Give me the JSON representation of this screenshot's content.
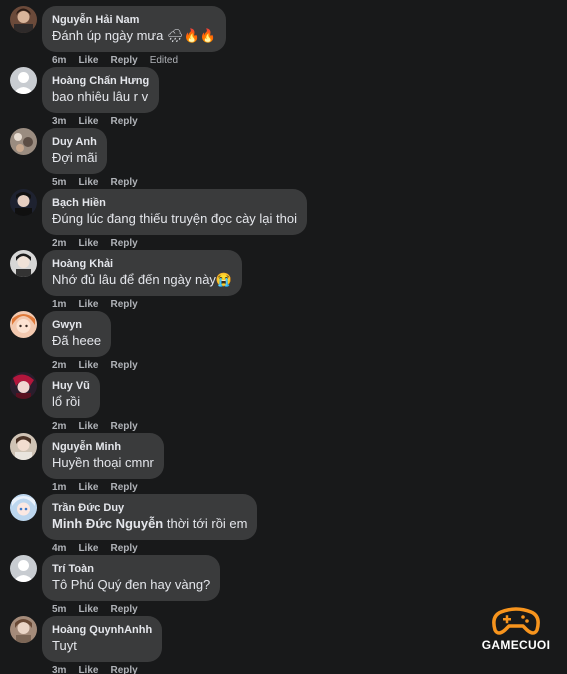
{
  "labels": {
    "like": "Like",
    "reply": "Reply",
    "edited": "Edited"
  },
  "comments": [
    {
      "author": "Nguyễn Hải Nam",
      "text": "Đánh úp ngày mưa 🌧🔥🔥",
      "time": "6m",
      "edited": true
    },
    {
      "author": "Hoàng Chấn Hưng",
      "text": "bao nhiêu lâu r v",
      "time": "3m"
    },
    {
      "author": "Duy Anh",
      "text": "Đợi mãi",
      "time": "5m"
    },
    {
      "author": "Bạch Hiền",
      "text": "Đúng lúc đang thiếu truyện đọc cày lại thoi",
      "time": "2m"
    },
    {
      "author": "Hoàng Khải",
      "text": "Nhớ đủ lâu để đến ngày này😭",
      "time": "1m"
    },
    {
      "author": "Gwyn",
      "text": "Đã heee",
      "time": "2m"
    },
    {
      "author": "Huy Vũ",
      "text": "lổ rồi",
      "time": "2m"
    },
    {
      "author": "Nguyễn Minh",
      "text": "Huyền thoại cmnr",
      "time": "1m"
    },
    {
      "author": "Trần Đức Duy",
      "mention": "Minh Đức Nguyễn",
      "text": " thời tới rồi em",
      "time": "4m"
    },
    {
      "author": "Trí Toàn",
      "text": "Tô Phú Quý đen hay vàng?",
      "time": "5m"
    },
    {
      "author": "Hoàng QuynhAnhh",
      "text": "Tuyt",
      "time": "3m"
    }
  ],
  "watermark": {
    "brand": "GAMECUOI",
    "color": "#f7941d"
  },
  "colors": {
    "background": "#18191a",
    "bubble": "#3a3b3c",
    "text": "#e4e6eb",
    "meta": "#b0b3b8"
  }
}
